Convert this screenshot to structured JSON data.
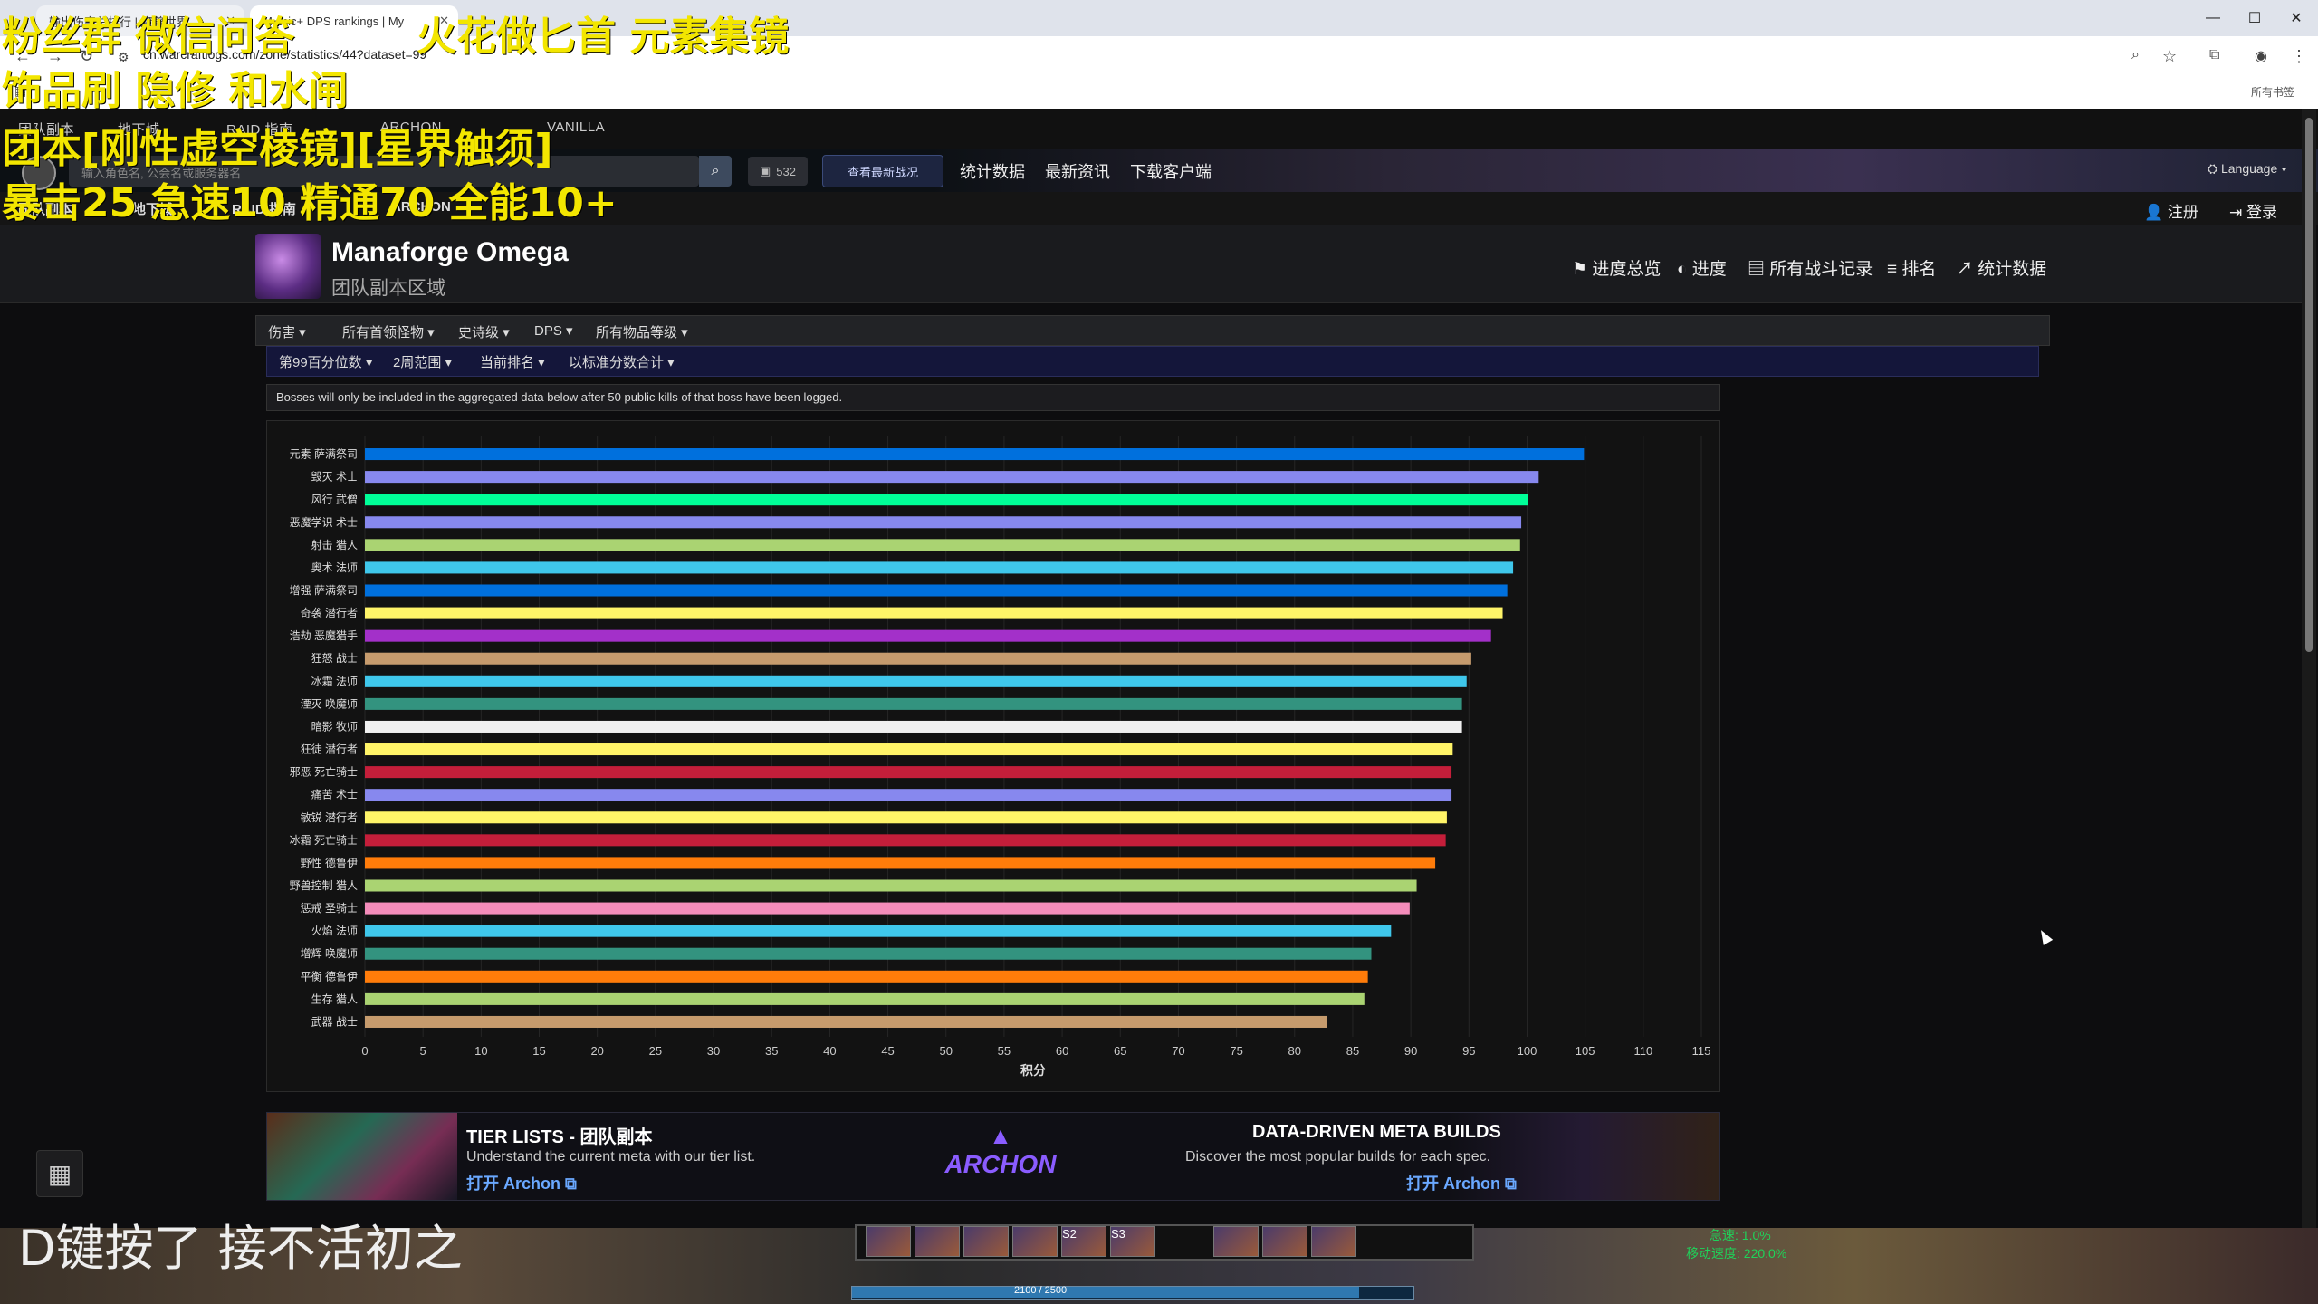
{
  "browser": {
    "tabs": [
      {
        "title": "输出伤害总排行 | 魔兽世界"
      },
      {
        "title": "Mythic+ DPS rankings | My"
      }
    ],
    "url": "cn.warcraftlogs.com/zone/statistics/44?dataset=99",
    "bookmarks_label": "所有书签"
  },
  "site": {
    "top_nav": [
      "团队副本",
      "地下城",
      "RAID 指南",
      "ARCHON",
      "VANILLA"
    ],
    "search_placeholder": "输入角色名, 公会名或服务器名",
    "chat_count": "532",
    "live_label": "查看最新战况",
    "header_links": [
      "统计数据",
      "最新资讯",
      "下载客户端"
    ],
    "language": "Language",
    "sub_nav": [
      "团队副本",
      "地下城",
      "RAID 指南",
      "ARCHON"
    ],
    "register": "注册",
    "login": "登录"
  },
  "zone": {
    "title": "Manaforge Omega",
    "subtitle": "团队副本区域",
    "links": [
      "进度总览",
      "进度",
      "所有战斗记录",
      "排名",
      "统计数据"
    ]
  },
  "filters": {
    "row1": [
      "伤害",
      "所有首领怪物",
      "史诗级",
      "DPS",
      "所有物品等级"
    ],
    "row2": [
      "第99百分位数",
      "2周范围",
      "当前排名",
      "以标准分数合计"
    ]
  },
  "notice": "Bosses will only be included in the aggregated data below after 50 public kills of that boss have been logged.",
  "chart_data": {
    "type": "bar",
    "orientation": "horizontal",
    "xlabel": "积分",
    "xlim": [
      0,
      115
    ],
    "xticks": [
      0,
      5,
      10,
      15,
      20,
      25,
      30,
      35,
      40,
      45,
      50,
      55,
      60,
      65,
      70,
      75,
      80,
      85,
      90,
      95,
      100,
      105,
      110,
      115
    ],
    "grid": true,
    "categories": [
      "元素 萨满祭司",
      "毁灭 术士",
      "风行 武僧",
      "恶魔学识 术士",
      "射击 猎人",
      "奥术 法师",
      "增强 萨满祭司",
      "奇袭 潜行者",
      "浩劫 恶魔猎手",
      "狂怒 战士",
      "冰霜 法师",
      "湮灭 唤魔师",
      "暗影 牧师",
      "狂徒 潜行者",
      "邪恶 死亡骑士",
      "痛苦 术士",
      "敏锐 潜行者",
      "冰霜 死亡骑士",
      "野性 德鲁伊",
      "野兽控制 猎人",
      "惩戒 圣骑士",
      "火焰 法师",
      "增辉 唤魔师",
      "平衡 德鲁伊",
      "生存 猎人",
      "武器 战士"
    ],
    "values": [
      104.9,
      101.0,
      100.1,
      99.5,
      99.4,
      98.8,
      98.3,
      97.9,
      96.9,
      95.2,
      94.8,
      94.4,
      94.4,
      93.6,
      93.5,
      93.5,
      93.1,
      93.0,
      92.1,
      90.5,
      89.9,
      88.3,
      86.6,
      86.3,
      86.0,
      82.8
    ],
    "colors": [
      "#0070DD",
      "#8788EE",
      "#00FF98",
      "#8788EE",
      "#AAD372",
      "#3FC7EB",
      "#0070DD",
      "#FFF468",
      "#A330C9",
      "#C69B6D",
      "#3FC7EB",
      "#33937F",
      "#F0F0F0",
      "#FFF468",
      "#C41E3A",
      "#8788EE",
      "#FFF468",
      "#C41E3A",
      "#FF7C0A",
      "#AAD372",
      "#F48CBA",
      "#3FC7EB",
      "#33937F",
      "#FF7C0A",
      "#AAD372",
      "#C69B6D"
    ]
  },
  "archon": {
    "left_title": "TIER LISTS - 团队副本",
    "left_desc": "Understand the current meta with our tier list.",
    "left_link": "打开 Archon",
    "logo": "ARCHON",
    "right_title": "DATA-DRIVEN META BUILDS",
    "right_desc": "Discover the most popular builds for each spec.",
    "right_link": "打开 Archon"
  },
  "overlays": {
    "line1": "粉丝群 微信问答",
    "line1b": "火花做匕首 元素集镜",
    "line2": "饰品刷 隐修 和水闸",
    "line3": "团本[刚性虚空棱镜][星界触须]",
    "line4": "暴击25 急速10 精通70 全能10+"
  },
  "game": {
    "bottom_text": "D键按了 接不活初之",
    "cast_text": "2100 / 2500",
    "stat1": "急速: 1.0%",
    "stat2": "移动速度: 220.0%",
    "slot_labels": [
      "S2",
      "S3"
    ]
  }
}
